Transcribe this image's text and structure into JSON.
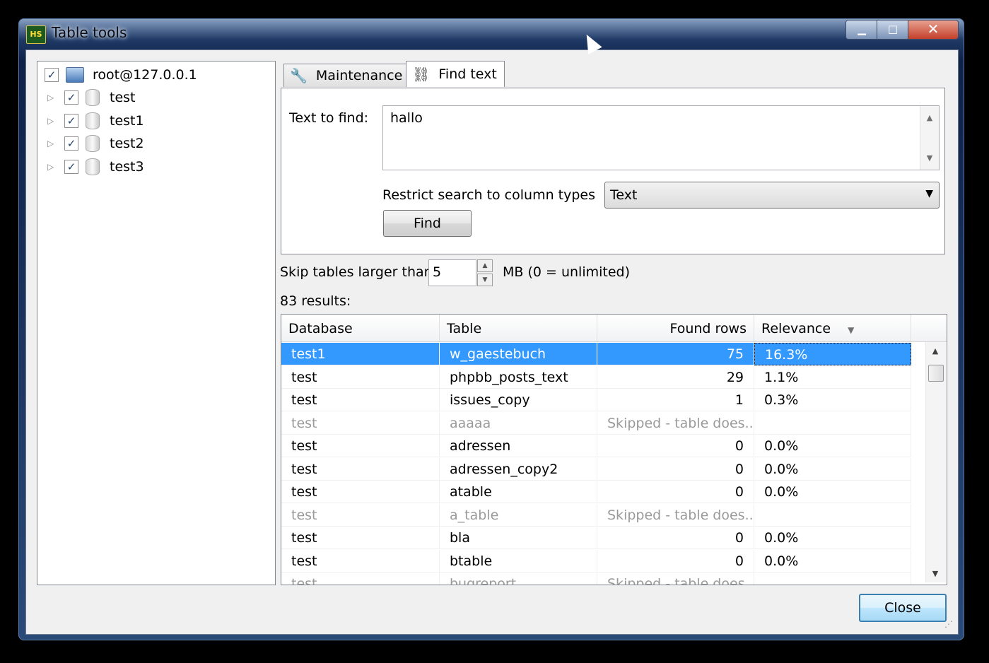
{
  "window": {
    "title": "Table tools",
    "icon_text": "HS",
    "minimize_glyph": "▁",
    "maximize_glyph": "□",
    "close_glyph": "✕"
  },
  "tree": {
    "root": {
      "label": "root@127.0.0.1",
      "checked": true
    },
    "databases": [
      {
        "label": "test",
        "checked": true
      },
      {
        "label": "test1",
        "checked": true
      },
      {
        "label": "test2",
        "checked": true
      },
      {
        "label": "test3",
        "checked": true
      }
    ],
    "check_glyph": "✓",
    "expand_glyph": "▷"
  },
  "tabs": [
    {
      "label": "Maintenance",
      "icon": "wrench-icon",
      "active": false
    },
    {
      "label": "Find text",
      "icon": "binoculars-icon",
      "active": true
    }
  ],
  "find": {
    "text_label": "Text to find:",
    "text_value": "hallo",
    "restrict_label": "Restrict search to column types",
    "column_type": "Text",
    "find_button": "Find"
  },
  "skip": {
    "label": "Skip tables larger than",
    "value": "5",
    "unit_label": "MB (0 = unlimited)"
  },
  "results": {
    "count_label": "83 results:",
    "columns": [
      "Database",
      "Table",
      "Found rows",
      "Relevance"
    ],
    "sort_glyph": "▼",
    "rows": [
      {
        "database": "test1",
        "table": "w_gaestebuch",
        "found": "75",
        "relevance": "16.3%",
        "selected": true,
        "skipped": false
      },
      {
        "database": "test",
        "table": "phpbb_posts_text",
        "found": "29",
        "relevance": "1.1%",
        "selected": false,
        "skipped": false
      },
      {
        "database": "test",
        "table": "issues_copy",
        "found": "1",
        "relevance": "0.3%",
        "selected": false,
        "skipped": false
      },
      {
        "database": "test",
        "table": "aaaaa",
        "found": "Skipped - table does...",
        "relevance": "",
        "selected": false,
        "skipped": true
      },
      {
        "database": "test",
        "table": "adressen",
        "found": "0",
        "relevance": "0.0%",
        "selected": false,
        "skipped": false
      },
      {
        "database": "test",
        "table": "adressen_copy2",
        "found": "0",
        "relevance": "0.0%",
        "selected": false,
        "skipped": false
      },
      {
        "database": "test",
        "table": "atable",
        "found": "0",
        "relevance": "0.0%",
        "selected": false,
        "skipped": false
      },
      {
        "database": "test",
        "table": "a_table",
        "found": "Skipped - table does...",
        "relevance": "",
        "selected": false,
        "skipped": true
      },
      {
        "database": "test",
        "table": "bla",
        "found": "0",
        "relevance": "0.0%",
        "selected": false,
        "skipped": false
      },
      {
        "database": "test",
        "table": "btable",
        "found": "0",
        "relevance": "0.0%",
        "selected": false,
        "skipped": false
      },
      {
        "database": "test",
        "table": "bugreport",
        "found": "Skipped - table does...",
        "relevance": "",
        "selected": false,
        "skipped": true
      }
    ]
  },
  "close_button": "Close"
}
